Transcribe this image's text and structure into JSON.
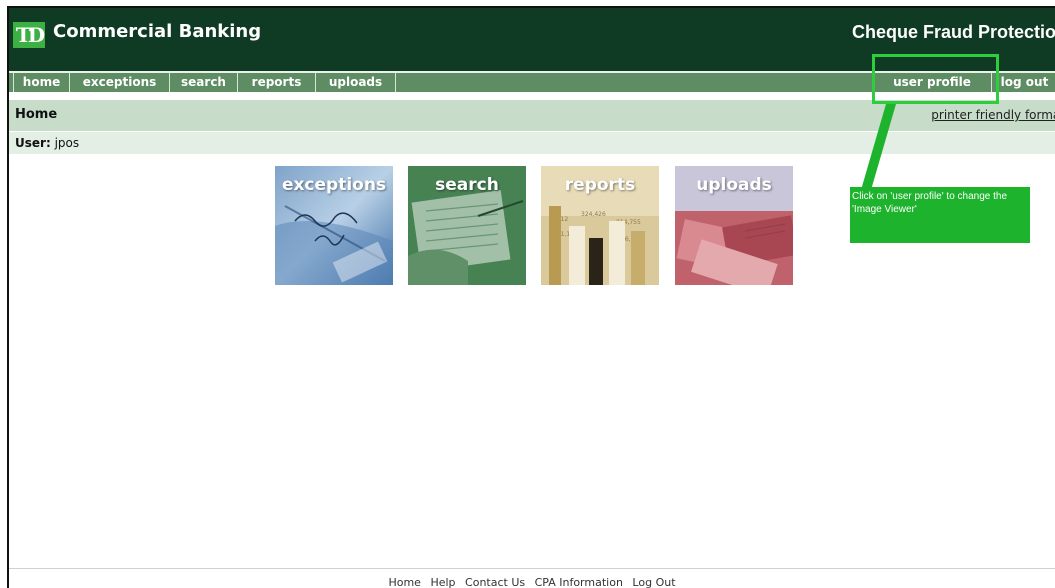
{
  "header": {
    "logo_text": "TD",
    "brand": "Commercial Banking",
    "product": "Cheque Fraud Protection"
  },
  "nav": {
    "left": [
      "home",
      "exceptions",
      "search",
      "reports",
      "uploads"
    ],
    "right": [
      "user profile",
      "log out"
    ]
  },
  "page": {
    "title": "Home",
    "printer_link": "printer friendly format",
    "user_label": "User:",
    "user_value": "jpos"
  },
  "tiles": [
    "exceptions",
    "search",
    "reports",
    "uploads"
  ],
  "annotation": {
    "text": "Click on 'user profile' to change the 'Image Viewer'",
    "color": "#1db32d"
  },
  "footer": [
    "Home",
    "Help",
    "Contact Us",
    "CPA Information",
    "Log Out"
  ],
  "colors": {
    "header_bg": "#0f3a24",
    "nav_bg": "#5e8c63",
    "title_bg": "#c7ddc9",
    "logo_green": "#3cb043"
  }
}
